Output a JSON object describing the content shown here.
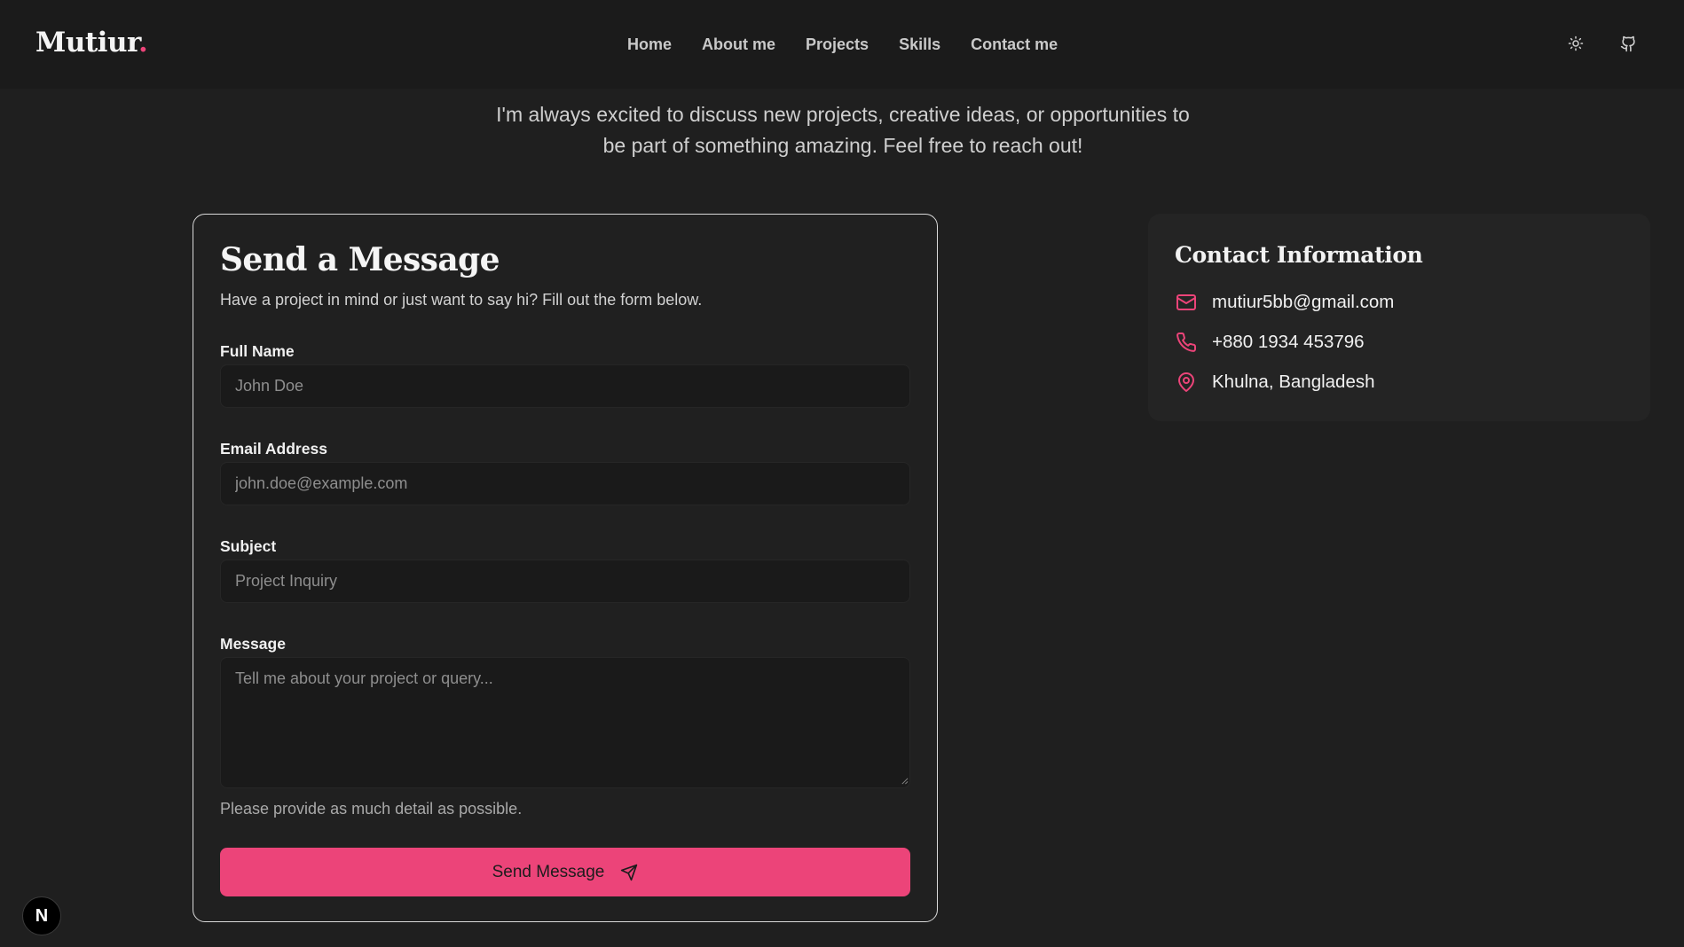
{
  "header": {
    "logo_text": "Mutiur",
    "logo_dot": ".",
    "nav": [
      "Home",
      "About me",
      "Projects",
      "Skills",
      "Contact me"
    ],
    "theme_icon": "sun-icon",
    "github_icon": "github-icon"
  },
  "intro": {
    "line1": "I'm always excited to discuss new projects, creative ideas, or opportunities to",
    "line2": "be part of something amazing. Feel free to reach out!"
  },
  "form": {
    "title": "Send a Message",
    "subtitle": "Have a project in mind or just want to say hi? Fill out the form below.",
    "name_label": "Full Name",
    "name_placeholder": "John Doe",
    "email_label": "Email Address",
    "email_placeholder": "john.doe@example.com",
    "subject_label": "Subject",
    "subject_placeholder": "Project Inquiry",
    "message_label": "Message",
    "message_placeholder": "Tell me about your project or query...",
    "hint": "Please provide as much detail as possible.",
    "submit_label": "Send Message",
    "submit_icon": "send-icon"
  },
  "contact": {
    "title": "Contact Information",
    "email": "mutiur5bb@gmail.com",
    "phone": "+880 1934 453796",
    "location": "Khulna, Bangladesh"
  },
  "badge": {
    "label": "N"
  },
  "colors": {
    "accent": "#ec4479",
    "background": "#1f1f1f"
  }
}
